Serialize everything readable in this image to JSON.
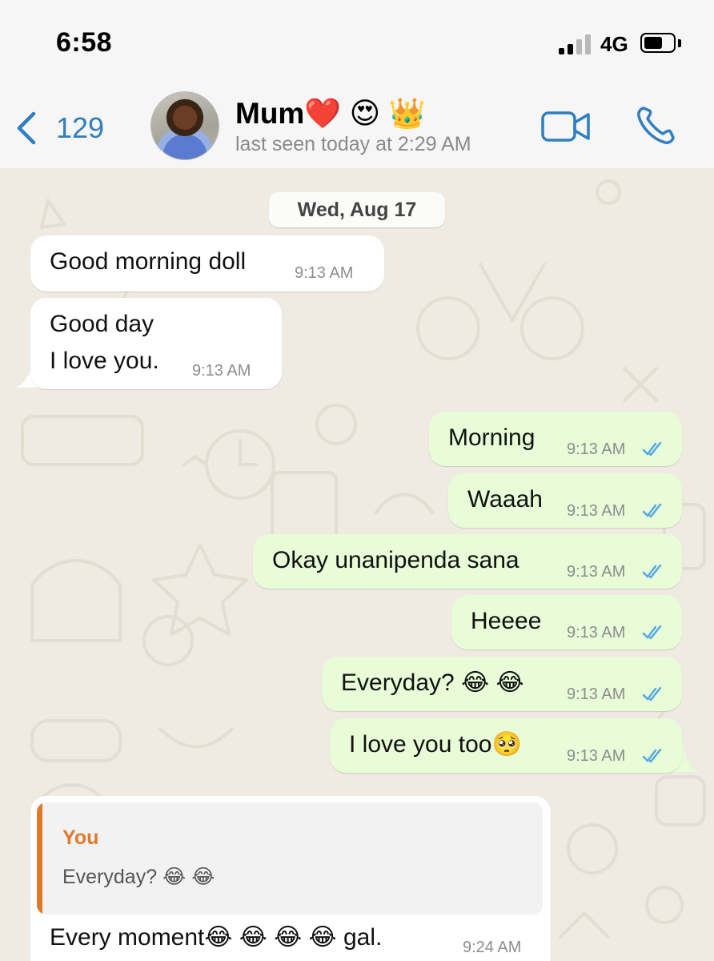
{
  "status_bar": {
    "time": "6:58",
    "network": "4G",
    "battery_level": 0.55
  },
  "header": {
    "back_count": "129",
    "contact_name": "Mum❤️ 😍 👑",
    "last_seen": "last seen today at 2:29 AM",
    "icons": [
      "chevron-left-icon",
      "video-call-icon",
      "phone-icon"
    ],
    "accent_color": "#2f7fc1"
  },
  "chat": {
    "date_label": "Wed, Aug 17",
    "messages": [
      {
        "direction": "incoming",
        "text": "Good morning doll",
        "time": "9:13 AM"
      },
      {
        "direction": "incoming",
        "lines": [
          "Good day",
          "I love you."
        ],
        "time": "9:13 AM"
      },
      {
        "direction": "outgoing",
        "text": "Morning",
        "time": "9:13 AM",
        "status": "read"
      },
      {
        "direction": "outgoing",
        "text": "Waaah",
        "time": "9:13 AM",
        "status": "read"
      },
      {
        "direction": "outgoing",
        "text": "Okay unanipenda sana",
        "time": "9:13 AM",
        "status": "read"
      },
      {
        "direction": "outgoing",
        "text": "Heeee",
        "time": "9:13 AM",
        "status": "read"
      },
      {
        "direction": "outgoing",
        "text": "Everyday? 😂 😂",
        "time": "9:13 AM",
        "status": "read"
      },
      {
        "direction": "outgoing",
        "text": "I love you too🥺",
        "time": "9:13 AM",
        "status": "read"
      },
      {
        "direction": "incoming",
        "reply_to": {
          "author": "You",
          "text": "Everyday? 😂 😂"
        },
        "text": "Every moment😂 😂 😂 😂  gal.",
        "time": "9:24 AM"
      }
    ]
  },
  "colors": {
    "incoming_bubble": "#ffffff",
    "outgoing_bubble": "#e7fcd7",
    "read_ticks": "#53a6e8",
    "reply_accent": "#e07a2b",
    "chat_background": "#efeae2"
  }
}
